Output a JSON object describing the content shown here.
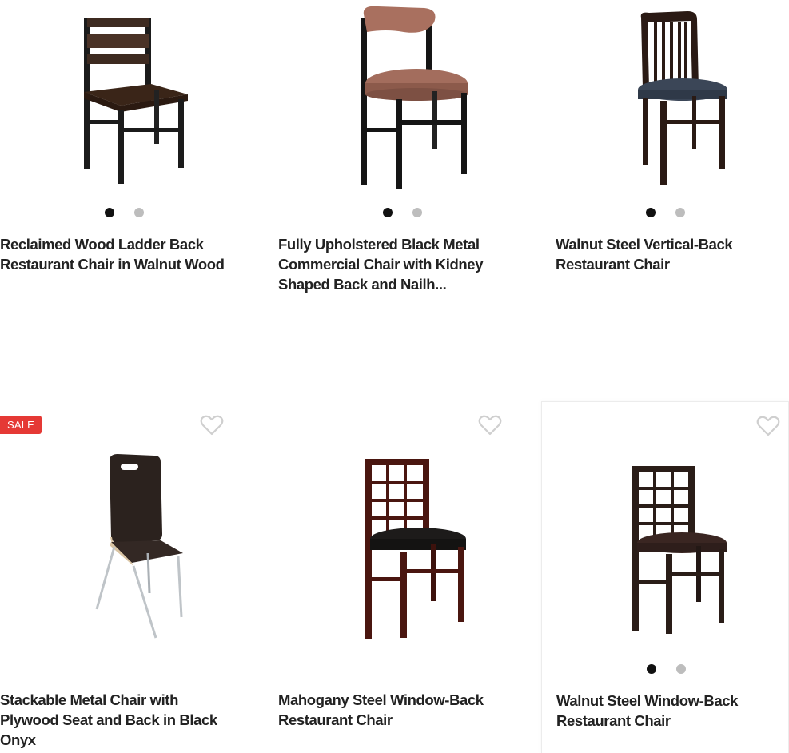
{
  "products": [
    {
      "title": "Reclaimed Wood Ladder Back Restaurant Chair in Walnut Wood",
      "image": "chair-ladder-back-walnut",
      "sale": false,
      "has_dots": true,
      "has_heart": false
    },
    {
      "title": "Fully Upholstered Black Metal Commercial Chair with Kidney Shaped Back and Nailh...",
      "image": "chair-kidney-back-black-metal",
      "sale": false,
      "has_dots": true,
      "has_heart": false
    },
    {
      "title": "Walnut Steel Vertical-Back Restaurant Chair",
      "image": "chair-vertical-back-walnut",
      "sale": false,
      "has_dots": true,
      "has_heart": false
    },
    {
      "title": "Stackable Metal Chair with Plywood Seat and Back in Black Onyx",
      "image": "chair-stackable-plywood-onyx",
      "sale": true,
      "sale_label": "SALE",
      "has_dots": false,
      "has_heart": true
    },
    {
      "title": "Mahogany Steel Window-Back Restaurant Chair",
      "image": "chair-window-back-mahogany",
      "sale": false,
      "has_dots": false,
      "has_heart": true
    },
    {
      "title": "Walnut Steel Window-Back Restaurant Chair",
      "image": "chair-window-back-walnut",
      "sale": false,
      "has_dots": true,
      "has_heart": true
    }
  ],
  "colors": {
    "sale_badge": "#e53935",
    "dot_active": "#111111",
    "dot_inactive": "#bdbdbd",
    "heart_outline": "#cfcfcf"
  },
  "icons": {
    "wishlist": "heart-outline-icon",
    "carousel_dot": "carousel-dot"
  }
}
